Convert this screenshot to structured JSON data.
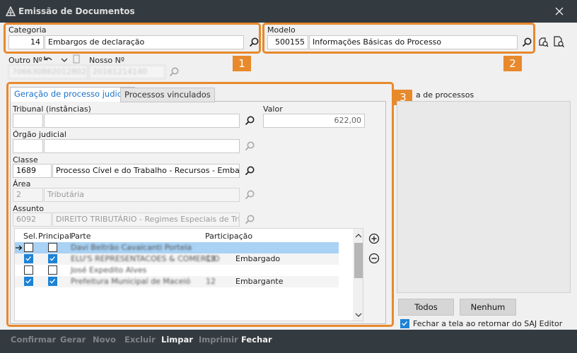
{
  "window": {
    "title": "Emissão de Documentos"
  },
  "categoria": {
    "label": "Categoria",
    "code": "14",
    "name": "Embargos de declaração"
  },
  "modelo": {
    "label": "Modelo",
    "code": "500155",
    "name": "Informações Básicas do Processo"
  },
  "outro_numero": {
    "label": "Outro Nº",
    "value": "7066308620128028"
  },
  "nosso_numero": {
    "label": "Nosso Nº",
    "value": "20161214140"
  },
  "tabs": [
    {
      "label": "Geração de processo judicial"
    },
    {
      "label": "Processos vinculados"
    }
  ],
  "form": {
    "tribunal": {
      "label": "Tribunal (instâncias)",
      "code": "",
      "name": ""
    },
    "valor": {
      "label": "Valor",
      "value": "622,00"
    },
    "orgao": {
      "label": "Órgão judicial",
      "code": "",
      "name": ""
    },
    "classe": {
      "label": "Classe",
      "code": "1689",
      "name": "Processo Cível e do Trabalho - Recursos - Embargos"
    },
    "area": {
      "label": "Área",
      "code": "2",
      "name": "Tributária"
    },
    "assunto": {
      "label": "Assunto",
      "code": "6092",
      "name": "DIREITO TRIBUTÁRIO - Regimes Especiais de Tribut"
    }
  },
  "parties": {
    "headers": [
      "Sel.",
      "Principal",
      "Parte",
      "Participação"
    ],
    "rows": [
      {
        "sel": false,
        "principal": false,
        "parte": "Davi Beltrão Cavalcanti Portela",
        "doc": "",
        "participacao": ""
      },
      {
        "sel": true,
        "principal": true,
        "parte": "ELU'S REPRESENTACOES & COMERCIO",
        "doc": "13",
        "participacao": "Embargado"
      },
      {
        "sel": false,
        "principal": false,
        "parte": "José Expedito Alves",
        "doc": "",
        "participacao": ""
      },
      {
        "sel": true,
        "principal": true,
        "parte": "Prefeitura Municipal de Maceió",
        "doc": "12",
        "participacao": "Embargante"
      }
    ]
  },
  "processos": {
    "label": "Lista de processos",
    "visible_label": "a de processos"
  },
  "buttons": {
    "todos": "Todos",
    "nenhum": "Nenhum"
  },
  "fechar_ao_retornar": {
    "label": "Fechar a tela ao retornar do SAJ Editor",
    "checked": true
  },
  "footer": {
    "actions": [
      {
        "label": "Confirmar",
        "enabled": false
      },
      {
        "label": "Gerar",
        "enabled": false
      },
      {
        "label": "Novo",
        "enabled": false
      },
      {
        "label": "Excluir",
        "enabled": false
      },
      {
        "label": "Limpar",
        "enabled": true
      },
      {
        "label": "Imprimir",
        "enabled": false
      },
      {
        "label": "Fechar",
        "enabled": true
      }
    ]
  },
  "badges": [
    "1",
    "2",
    "3"
  ],
  "colors": {
    "accent": "#e8892b",
    "titlebar": "#333a40",
    "link_blue": "#1a72c9",
    "check_blue": "#1c83d7"
  }
}
